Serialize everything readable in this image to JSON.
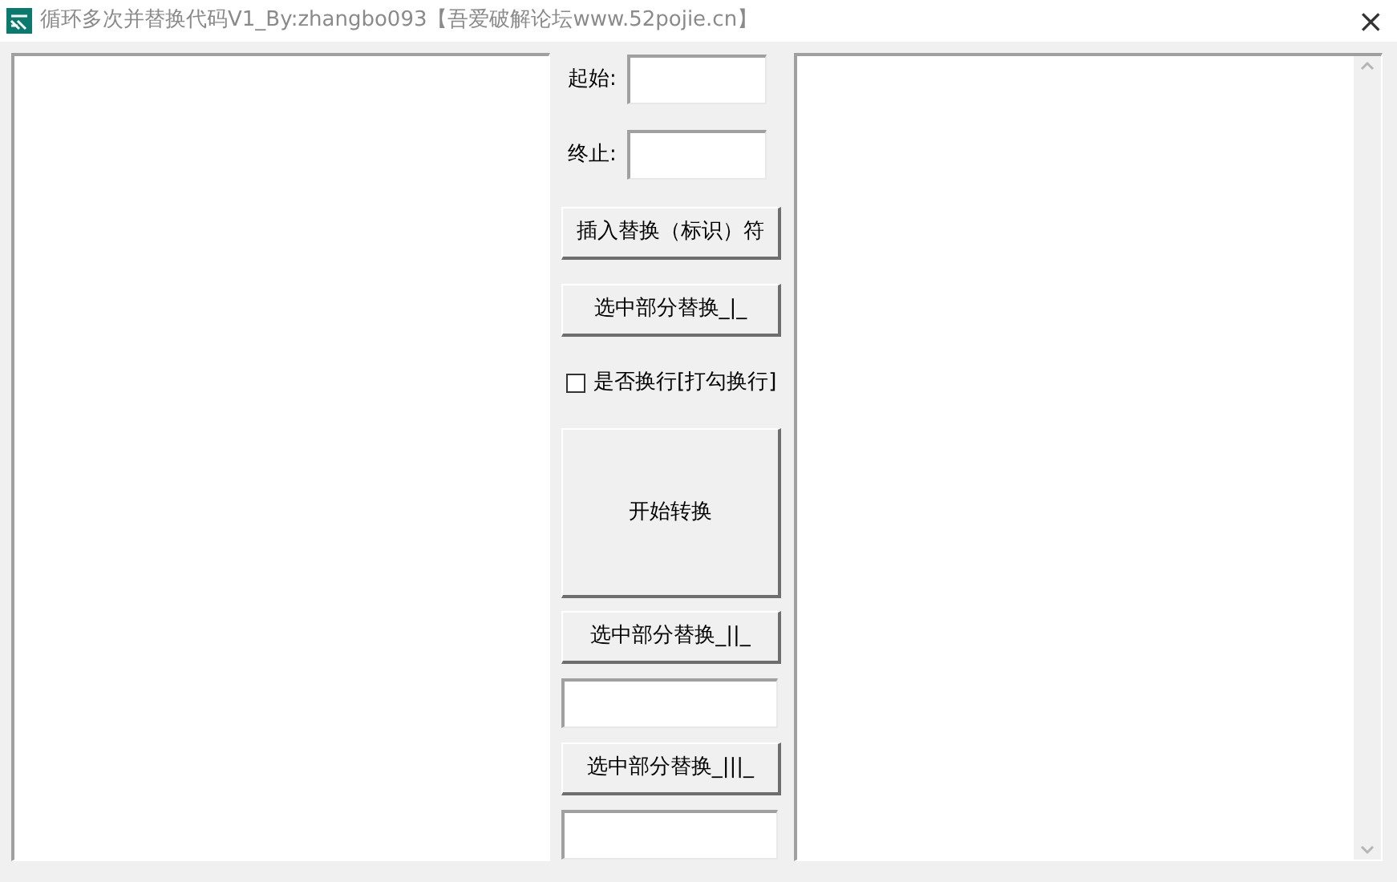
{
  "window": {
    "title": "循环多次并替换代码V1_By:zhangbo093【吾爱破解论坛www.52pojie.cn】",
    "close": "×"
  },
  "controls": [
    {
      "kind": "labeled_field",
      "label": "起始:"
    },
    {
      "kind": "labeled_field",
      "label": "终止:"
    },
    {
      "kind": "button",
      "label": "插入替换（标识）符"
    },
    {
      "kind": "button",
      "label": "选中部分替换_|_"
    },
    {
      "kind": "checkbox",
      "label": "是否换行[打勾换行]",
      "checked": false
    },
    {
      "kind": "big_button",
      "label": "开始转换"
    },
    {
      "kind": "button",
      "label": "选中部分替换_||_"
    },
    {
      "kind": "field"
    },
    {
      "kind": "button",
      "label": "选中部分替换_|||_"
    },
    {
      "kind": "field"
    }
  ]
}
